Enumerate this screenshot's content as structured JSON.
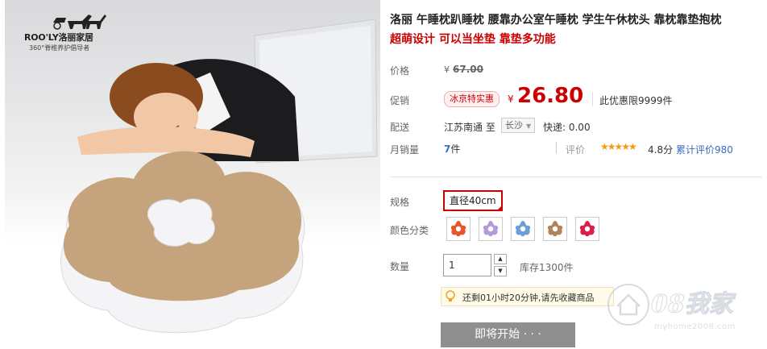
{
  "brand": {
    "name": "ROO'LY洛丽家居",
    "tagline": "360°脊椎养护倡导者"
  },
  "product": {
    "title": "洛丽 午睡枕趴睡枕 腰靠办公室午睡枕 学生午休枕头 靠枕靠垫抱枕",
    "subtitle": "超萌设计 可以当坐垫 靠垫多功能"
  },
  "price": {
    "label": "价格",
    "currency": "¥",
    "original": "67.00"
  },
  "promo": {
    "label": "促销",
    "badge": "冰京特实惠",
    "currency": "¥",
    "price": "26.80",
    "limit": "此优惠限9999件"
  },
  "shipping": {
    "label": "配送",
    "from": "江苏南通 至",
    "to": "长沙",
    "fee": "快递: 0.00"
  },
  "sales": {
    "label": "月销量",
    "count": "7",
    "unit": "件",
    "rating_label": "评价",
    "stars": "★★★★★",
    "rating": "4.8分",
    "reviews": "累计评价980"
  },
  "spec": {
    "label": "规格",
    "selected": "直径40cm"
  },
  "colors": {
    "label": "颜色分类",
    "swatches": [
      {
        "name": "orange",
        "color": "#e8552a"
      },
      {
        "name": "purple",
        "color": "#b49ad8"
      },
      {
        "name": "blue",
        "color": "#6c9fd8"
      },
      {
        "name": "tan",
        "color": "#b0845a"
      },
      {
        "name": "red",
        "color": "#d81f4a"
      }
    ]
  },
  "quantity": {
    "label": "数量",
    "value": "1",
    "stock": "库存1300件"
  },
  "tip": {
    "icon": "lightbulb-icon",
    "text": "还剩01小时20分钟,请先收藏商品"
  },
  "buy": {
    "label": "即将开始 · · ·"
  },
  "watermark": {
    "logo": "08我家",
    "url": "myhome2008.com"
  }
}
